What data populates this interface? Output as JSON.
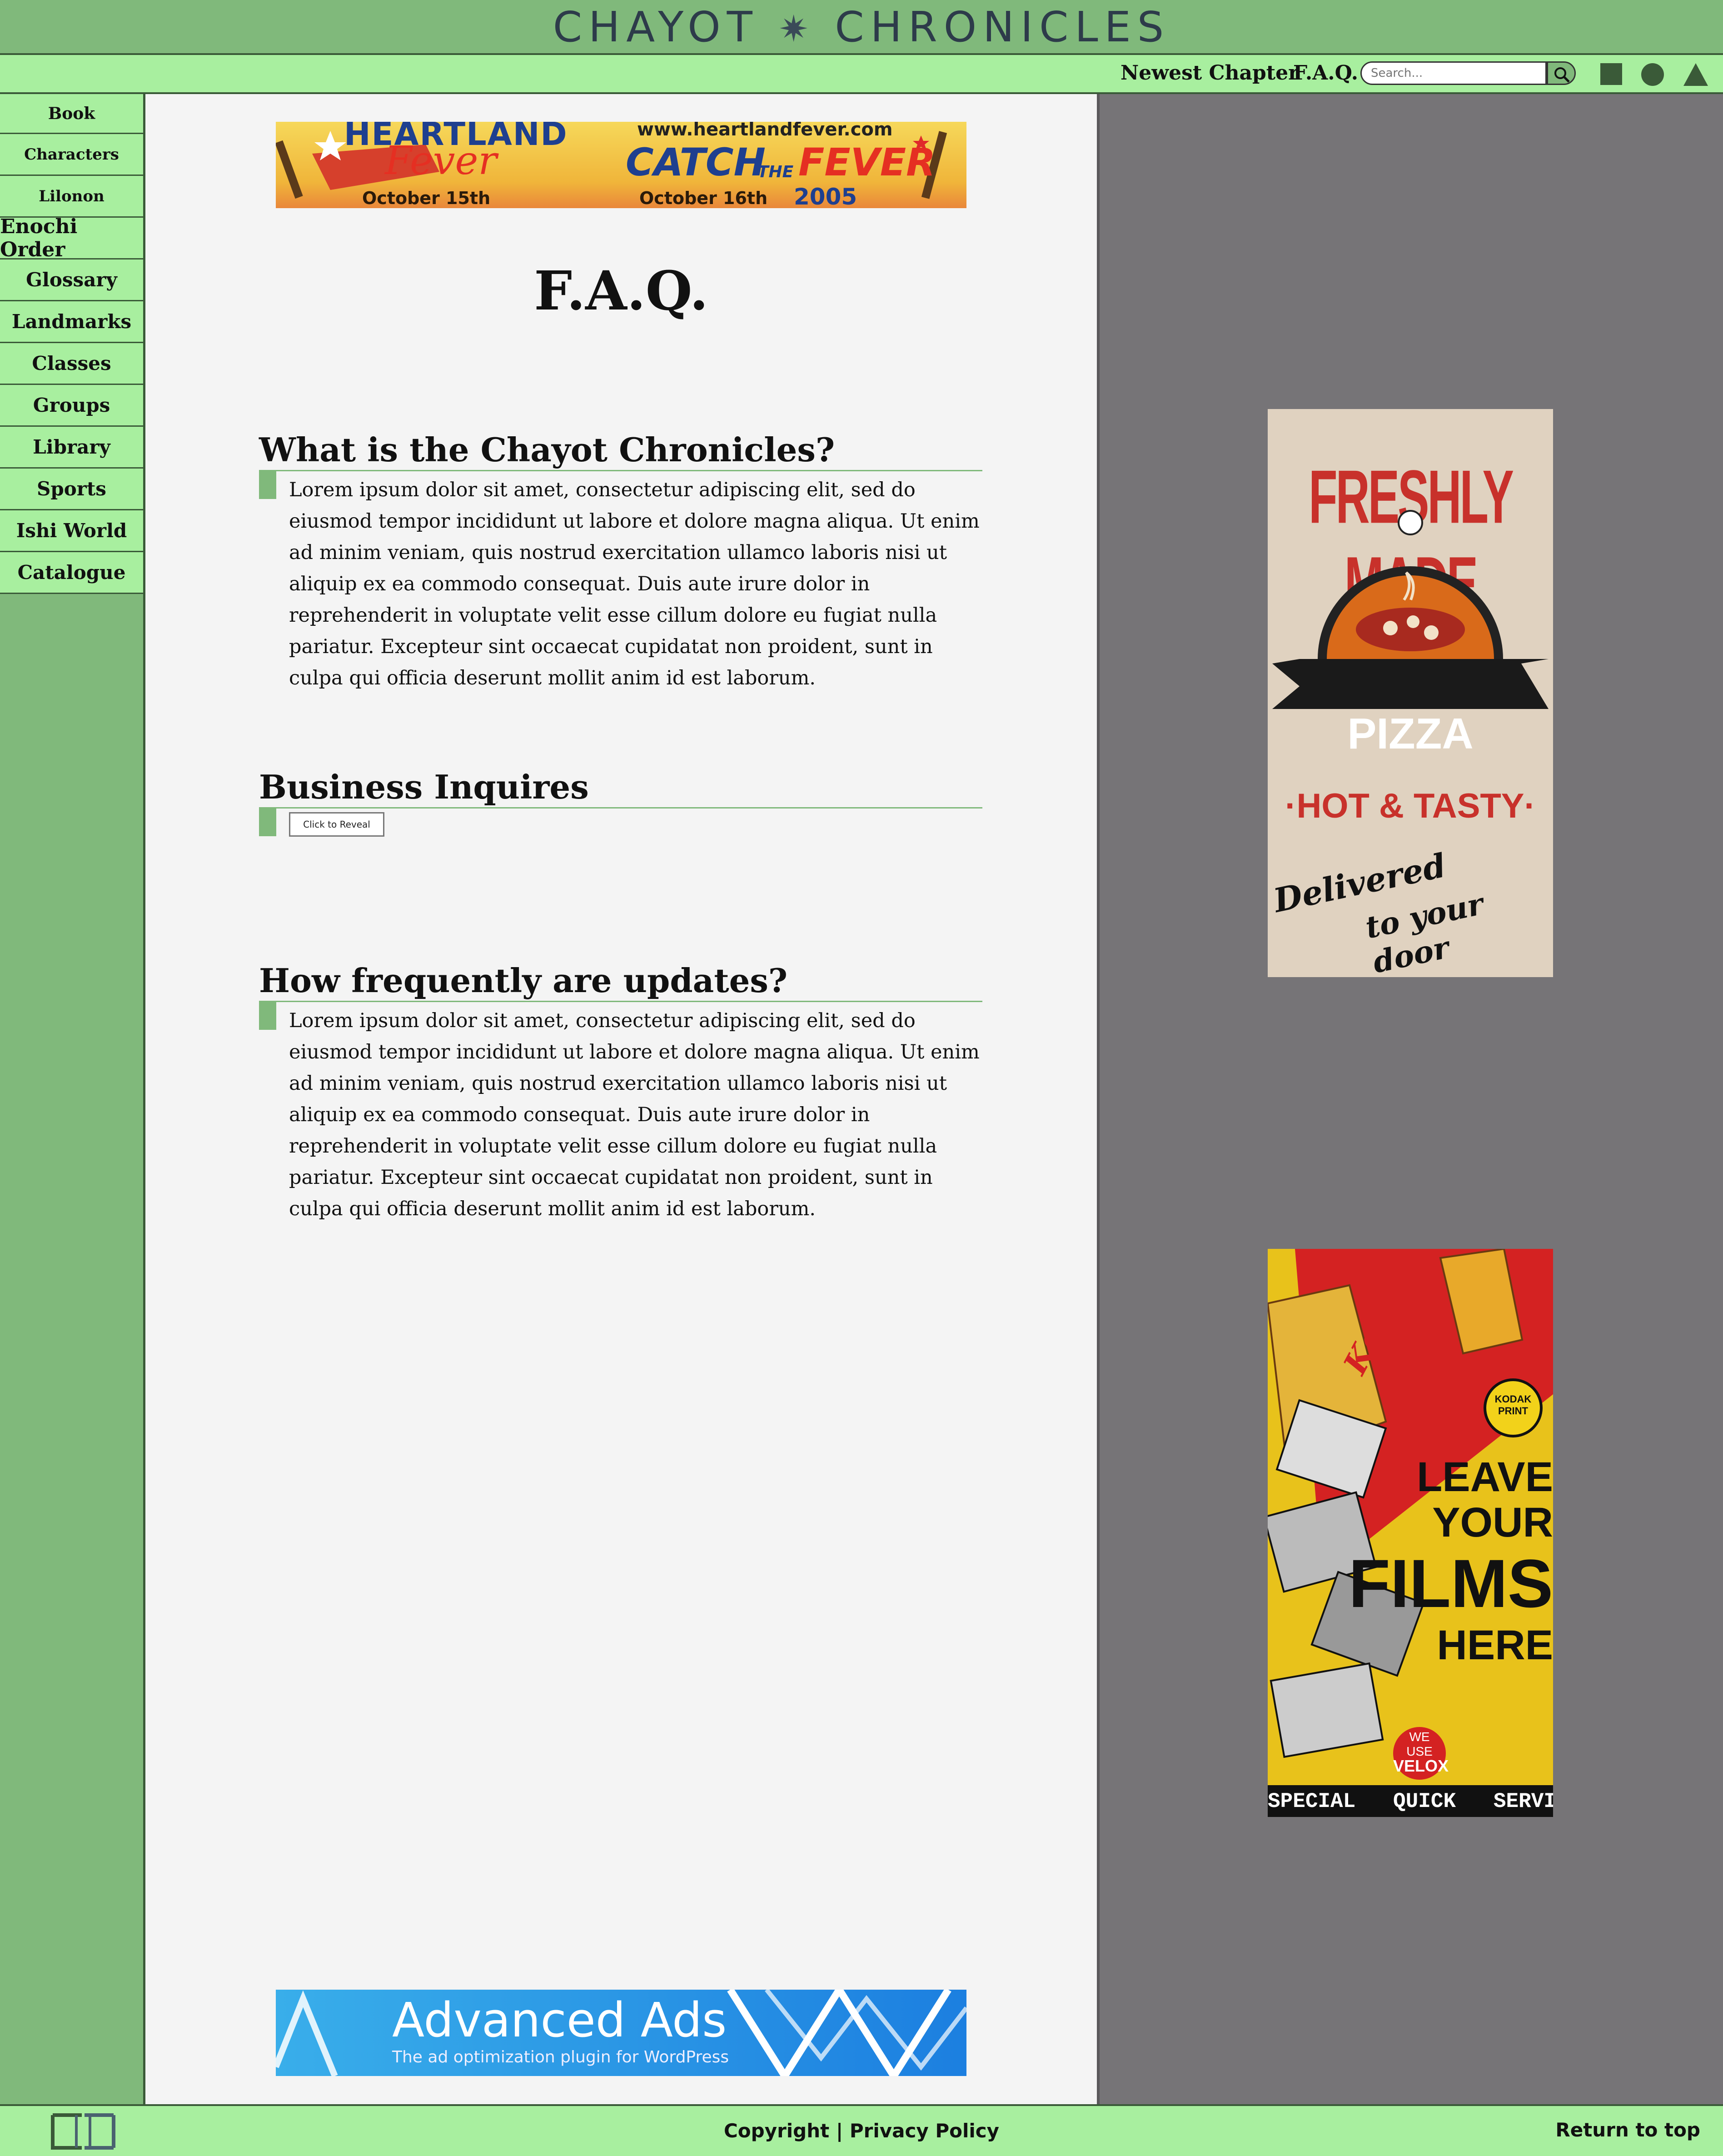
{
  "header": {
    "logo_left": "CHAYOT",
    "logo_star": "✷",
    "logo_right": "CHRONICLES"
  },
  "nav": {
    "newest_chapter": "Newest Chapter",
    "faq": "F.A.Q.",
    "search_placeholder": "Search...",
    "icons": [
      "search-icon",
      "square-icon",
      "circle-icon",
      "triangle-icon"
    ]
  },
  "sidebar": {
    "items": [
      {
        "label": "Book"
      },
      {
        "label": "Characters"
      },
      {
        "label": "Lilonon"
      },
      {
        "label": "Enochi Order"
      },
      {
        "label": "Glossary"
      },
      {
        "label": "Landmarks"
      },
      {
        "label": "Classes"
      },
      {
        "label": "Groups"
      },
      {
        "label": "Library"
      },
      {
        "label": "Sports"
      },
      {
        "label": "Ishi World"
      },
      {
        "label": "Catalogue"
      }
    ]
  },
  "ads": {
    "top_banner": {
      "line1": "HEARTLAND",
      "line2": "Fever",
      "url": "www.heartlandfever.com",
      "slogan_a": "CATCH",
      "slogan_b": "THE",
      "slogan_c": "FEVER",
      "date_left": "October 15th",
      "date_right": "October 16th",
      "year": "2005"
    },
    "pizza": {
      "headline": "FRESHLY MADE",
      "ribbon": "PIZZA",
      "tagline": "·HOT & TASTY·",
      "script1": "Delivered",
      "script2": "to your door"
    },
    "kodak": {
      "brand": "Kodak",
      "badge": "KODAK PRINT",
      "line1": "LEAVE",
      "line2": "YOUR",
      "line3": "FILMS",
      "line4": "HERE",
      "velox1": "WE",
      "velox2": "USE",
      "velox3": "VELOX",
      "footer": "SPECIAL   QUICK   SERVICE"
    },
    "bottom_banner": {
      "title": "Advanced Ads",
      "subtitle": "The ad optimization plugin for WordPress"
    }
  },
  "main": {
    "title": "F.A.Q.",
    "sections": [
      {
        "heading": "What is the Chayot Chronicles?",
        "body": "Lorem ipsum dolor sit amet, consectetur adipiscing elit, sed do eiusmod tempor incididunt ut labore et dolore magna aliqua. Ut enim ad minim veniam, quis nostrud exercitation ullamco laboris nisi ut aliquip ex ea commodo consequat. Duis aute irure dolor in reprehenderit in voluptate velit esse cillum dolore eu fugiat nulla pariatur. Excepteur sint occaecat cupidatat non proident, sunt in culpa qui officia deserunt mollit anim id est laborum."
      },
      {
        "heading": "Business Inquires",
        "button": "Click to Reveal"
      },
      {
        "heading": "How frequently are updates?",
        "body": "Lorem ipsum dolor sit amet, consectetur adipiscing elit, sed do eiusmod tempor incididunt ut labore et dolore magna aliqua. Ut enim ad minim veniam, quis nostrud exercitation ullamco laboris nisi ut aliquip ex ea commodo consequat. Duis aute irure dolor in reprehenderit in voluptate velit esse cillum dolore eu fugiat nulla pariatur. Excepteur sint occaecat cupidatat non proident, sunt in culpa qui officia deserunt mollit anim id est laborum."
      }
    ]
  },
  "footer": {
    "copyright": "Copyright",
    "separator": " | ",
    "privacy": "Privacy Policy",
    "return_top": "Return to top"
  },
  "colors": {
    "header_green": "#80b97b",
    "nav_green": "#a8ef9f",
    "dark_green": "#3a5a38",
    "content_bg": "#f4f4f4",
    "right_panel": "#767477"
  }
}
